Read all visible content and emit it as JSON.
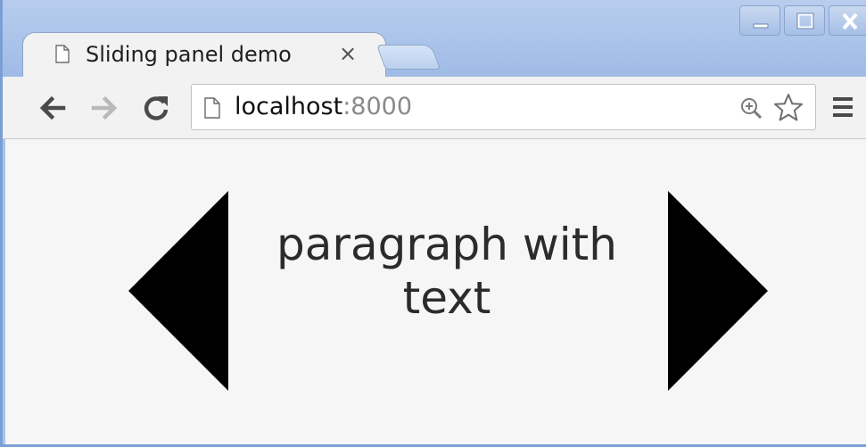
{
  "browser": {
    "tab": {
      "title": "Sliding panel demo",
      "close_label": "×",
      "icon": "page-icon"
    },
    "new_tab_icon": "new-tab-icon",
    "window_controls": [
      "minimize-icon",
      "maximize-icon",
      "close-icon"
    ],
    "toolbar": {
      "back_icon": "back-arrow-icon",
      "forward_icon": "forward-arrow-icon",
      "reload_icon": "reload-icon",
      "url_host": "localhost",
      "url_port": ":8000",
      "zoom_icon": "zoom-icon",
      "bookmark_icon": "star-icon",
      "menu_icon": "hamburger-menu-icon"
    }
  },
  "page": {
    "panel_text": "paragraph with text",
    "prev_icon": "left-triangle-arrow-icon",
    "next_icon": "right-triangle-arrow-icon"
  },
  "colors": {
    "frame": "#a9c3ea",
    "toolbar": "#f2f2f2",
    "page_background": "#f6f6f6",
    "arrow": "#000000",
    "text": "#2b2b2b",
    "url_port": "#8a8a8a"
  }
}
